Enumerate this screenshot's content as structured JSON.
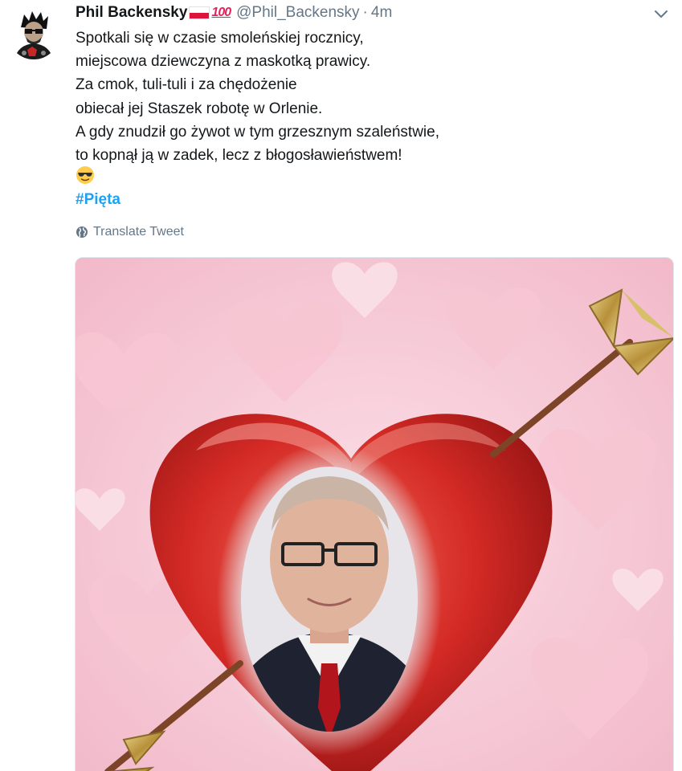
{
  "tweet": {
    "display_name": "Phil Backensky",
    "badge_text": "100",
    "handle": "@Phil_Backensky",
    "separator": "·",
    "timestamp": "4m",
    "lines": [
      "Spotkali się w czasie smoleńskiej rocznicy,",
      "miejscowa dziewczyna z maskotką prawicy.",
      "Za cmok, tuli-tuli i za chędożenie",
      "obiecał jej Staszek robotę w Orlenie.",
      "A gdy znudził go żywot w tym grzesznym szaleństwie,",
      "to kopnął ją w zadek, lecz z błogosławieństwem!"
    ],
    "emoji": "smiling-face-with-sunglasses",
    "hashtag": "#Pięta",
    "translate_label": "Translate Tweet"
  },
  "icons": {
    "menu": "chevron-down-icon",
    "translate": "globe-icon",
    "flag": "poland-flag-icon"
  },
  "colors": {
    "link_blue": "#1da1f2",
    "secondary_gray": "#657786",
    "text_dark": "#14171a",
    "heart_red": "#d42a25",
    "background_pink": "#f6c9d6",
    "arrow_gold": "#c9a94a"
  }
}
